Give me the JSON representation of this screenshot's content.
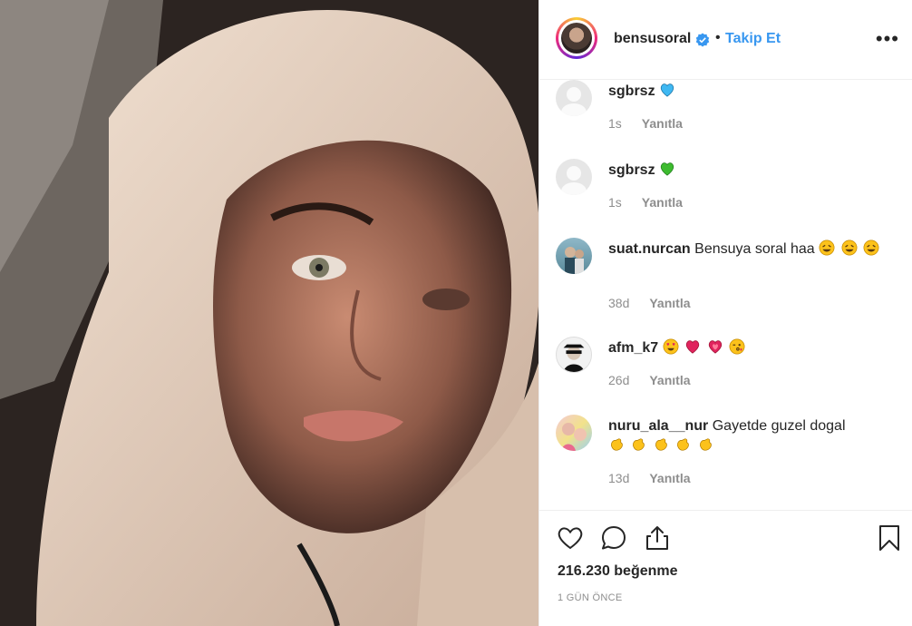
{
  "header": {
    "username": "bensusoral",
    "separator": "•",
    "follow_label": "Takip Et",
    "more_label": "•••"
  },
  "comments": [
    {
      "username": "sgbrsz",
      "text": "",
      "emojis": [
        "blue-heart"
      ],
      "age": "1s",
      "reply_label": "Yanıtla",
      "avatar": "blank"
    },
    {
      "username": "sgbrsz",
      "text": "",
      "emojis": [
        "green-heart"
      ],
      "age": "1s",
      "reply_label": "Yanıtla",
      "avatar": "blank"
    },
    {
      "username": "suat.nurcan",
      "text": "Bensuya soral haa",
      "emojis": [
        "rofl",
        "rofl",
        "rofl"
      ],
      "age": "38d",
      "reply_label": "Yanıtla",
      "avatar": "photo"
    },
    {
      "username": "afm_k7",
      "text": "",
      "emojis": [
        "heart-eyes",
        "red-heart",
        "growing-heart",
        "kissing-wink"
      ],
      "age": "26d",
      "reply_label": "Yanıtla",
      "avatar": "photo"
    },
    {
      "username": "nuru_ala__nur",
      "text": "Gayetde guzel dogal",
      "emojis": [
        "clap",
        "clap",
        "clap",
        "clap",
        "clap"
      ],
      "age": "13d",
      "reply_label": "Yanıtla",
      "avatar": "photo"
    }
  ],
  "actions": {
    "icons": [
      "heart-icon",
      "comment-icon",
      "share-icon",
      "bookmark-icon"
    ],
    "likes": "216.230 beğenme",
    "timestamp": "1 GÜN ÖNCE"
  },
  "colors": {
    "link": "#3897f0",
    "text": "#262626",
    "muted": "#8e8e8e"
  }
}
